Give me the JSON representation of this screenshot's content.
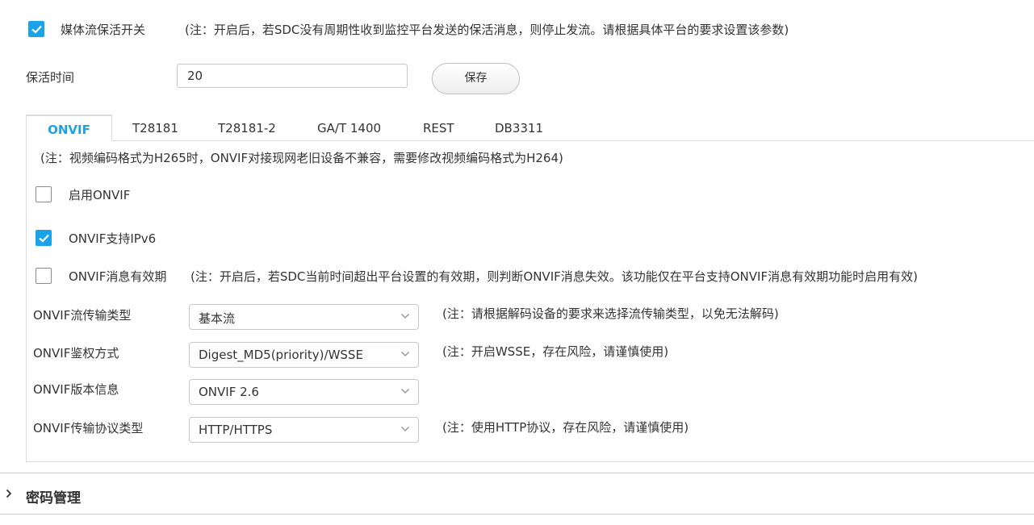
{
  "keepalive": {
    "toggle_label": "媒体流保活开关",
    "toggle_checked": true,
    "note": "(注：开启后，若SDC没有周期性收到监控平台发送的保活消息，则停止发流。请根据具体平台的要求设置该参数)",
    "time_label": "保活时间",
    "time_value": "20",
    "save_label": "保存"
  },
  "tabs": [
    {
      "label": "ONVIF",
      "active": true
    },
    {
      "label": "T28181",
      "active": false
    },
    {
      "label": "T28181-2",
      "active": false
    },
    {
      "label": "GA/T 1400",
      "active": false
    },
    {
      "label": "REST",
      "active": false
    },
    {
      "label": "DB3311",
      "active": false
    }
  ],
  "onvif": {
    "note": "(注：视频编码格式为H265时，ONVIF对接现网老旧设备不兼容，需要修改视频编码格式为H264)",
    "enable": {
      "label": "启用ONVIF",
      "checked": false
    },
    "ipv6": {
      "label": "ONVIF支持IPv6",
      "checked": true
    },
    "validity": {
      "label": "ONVIF消息有效期",
      "checked": false,
      "note": "(注：开启后，若SDC当前时间超出平台设置的有效期，则判断ONVIF消息失效。该功能仅在平台支持ONVIF消息有效期功能时启用有效)"
    },
    "stream_type": {
      "label": "ONVIF流传输类型",
      "value": "基本流",
      "note": "(注：请根据解码设备的要求来选择流传输类型，以免无法解码)"
    },
    "auth": {
      "label": "ONVIF鉴权方式",
      "value": "Digest_MD5(priority)/WSSE",
      "note": "(注：开启WSSE，存在风险，请谨慎使用)"
    },
    "version": {
      "label": "ONVIF版本信息",
      "value": "ONVIF 2.6"
    },
    "protocol": {
      "label": "ONVIF传输协议类型",
      "value": "HTTP/HTTPS",
      "note": "(注：使用HTTP协议，存在风险，请谨慎使用)"
    }
  },
  "password_section": {
    "title": "密码管理"
  },
  "colors": {
    "accent": "#1aa3e8",
    "border": "#dcdcdc",
    "text": "#333333"
  }
}
